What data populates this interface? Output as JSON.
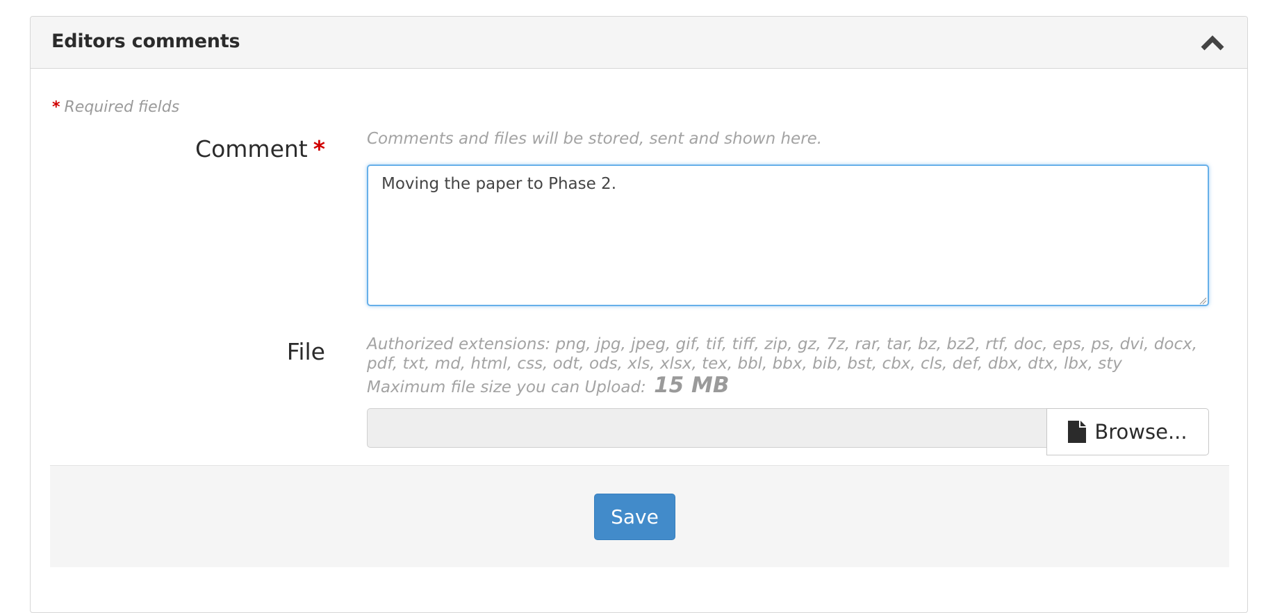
{
  "panel": {
    "title": "Editors comments",
    "collapse_icon": "chevron-up-icon"
  },
  "form": {
    "required_marker": "*",
    "required_note": "Required fields",
    "comment": {
      "label": "Comment",
      "required_marker": "*",
      "help": "Comments and files will be stored, sent and shown here.",
      "value": "Moving the paper to Phase 2."
    },
    "file": {
      "label": "File",
      "help_extensions": "Authorized extensions: png, jpg, jpeg, gif, tif, tiff, zip, gz, 7z, rar, tar, bz, bz2, rtf, doc, eps, ps, dvi, docx, pdf, txt, md, html, css, odt, ods, xls, xlsx, tex, bbl, bbx, bib, bst, cbx, cls, def, dbx, dtx, lbx, sty",
      "max_size_label": "Maximum file size you can Upload:",
      "max_size_value": "15 MB",
      "browse_label": "Browse...",
      "browse_icon": "file-icon",
      "selected_file": ""
    },
    "save_label": "Save"
  },
  "colors": {
    "accent": "#428bca",
    "required": "#d00000",
    "focus_border": "#66afe9",
    "panel_heading_bg": "#f5f5f5"
  }
}
